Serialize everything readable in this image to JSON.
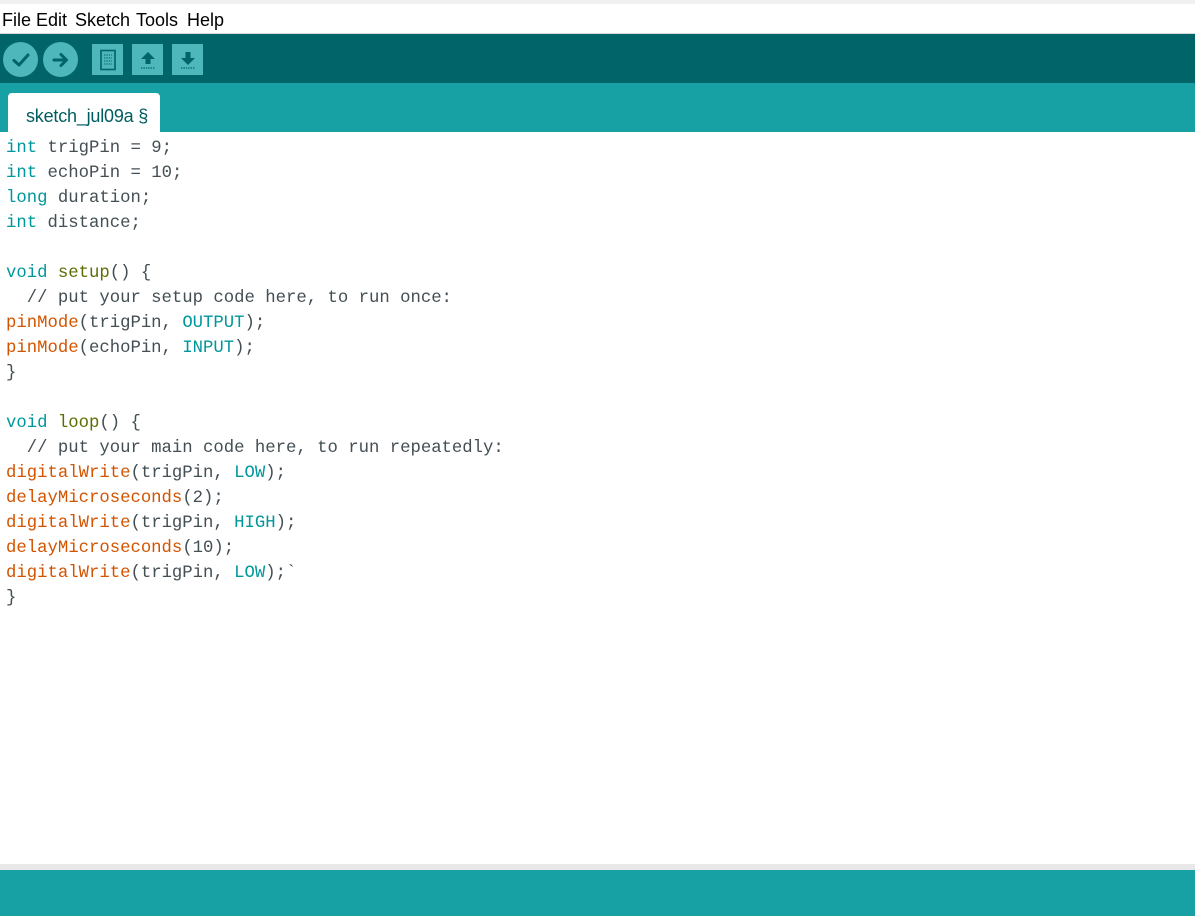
{
  "menu": {
    "items": [
      "File",
      "Edit",
      "Sketch",
      "Tools",
      "Help"
    ]
  },
  "toolbar": {
    "buttons": [
      {
        "name": "verify",
        "icon": "checkmark-icon"
      },
      {
        "name": "upload",
        "icon": "arrow-right-icon"
      },
      {
        "name": "new",
        "icon": "new-file-icon"
      },
      {
        "name": "open",
        "icon": "arrow-up-icon"
      },
      {
        "name": "save",
        "icon": "arrow-down-icon"
      }
    ]
  },
  "tab": {
    "label": "sketch_jul09a §"
  },
  "code": {
    "lines": [
      [
        {
          "t": "int",
          "c": "kw"
        },
        {
          "t": " trigPin = 9;"
        }
      ],
      [
        {
          "t": "int",
          "c": "kw"
        },
        {
          "t": " echoPin = 10;"
        }
      ],
      [
        {
          "t": "long",
          "c": "kw"
        },
        {
          "t": " duration;"
        }
      ],
      [
        {
          "t": "int",
          "c": "kw"
        },
        {
          "t": " distance;"
        }
      ],
      [],
      [
        {
          "t": "void",
          "c": "kw"
        },
        {
          "t": " "
        },
        {
          "t": "setup",
          "c": "sp"
        },
        {
          "t": "() {"
        }
      ],
      [
        {
          "t": "  // put your setup code here, to run once:",
          "c": "cm"
        }
      ],
      [
        {
          "t": "pinMode",
          "c": "fn"
        },
        {
          "t": "(trigPin, "
        },
        {
          "t": "OUTPUT",
          "c": "const"
        },
        {
          "t": ");"
        }
      ],
      [
        {
          "t": "pinMode",
          "c": "fn"
        },
        {
          "t": "(echoPin, "
        },
        {
          "t": "INPUT",
          "c": "const"
        },
        {
          "t": ");"
        }
      ],
      [
        {
          "t": "}"
        }
      ],
      [],
      [
        {
          "t": "void",
          "c": "kw"
        },
        {
          "t": " "
        },
        {
          "t": "loop",
          "c": "sp"
        },
        {
          "t": "() {"
        }
      ],
      [
        {
          "t": "  // put your main code here, to run repeatedly:",
          "c": "cm"
        }
      ],
      [
        {
          "t": "digitalWrite",
          "c": "fn"
        },
        {
          "t": "(trigPin, "
        },
        {
          "t": "LOW",
          "c": "const"
        },
        {
          "t": ");"
        }
      ],
      [
        {
          "t": "delayMicroseconds",
          "c": "fn"
        },
        {
          "t": "(2);"
        }
      ],
      [
        {
          "t": "digitalWrite",
          "c": "fn"
        },
        {
          "t": "(trigPin, "
        },
        {
          "t": "HIGH",
          "c": "const"
        },
        {
          "t": ");"
        }
      ],
      [
        {
          "t": "delayMicroseconds",
          "c": "fn"
        },
        {
          "t": "(10);"
        }
      ],
      [
        {
          "t": "digitalWrite",
          "c": "fn"
        },
        {
          "t": "(trigPin, "
        },
        {
          "t": "LOW",
          "c": "const"
        },
        {
          "t": ");`"
        }
      ],
      [
        {
          "t": "}"
        }
      ]
    ]
  },
  "colors": {
    "toolbar_bg": "#006468",
    "tab_strip_bg": "#17a1a5",
    "button_bg": "#4db7bb",
    "keyword": "#00979c",
    "function": "#d35400",
    "text": "#434f54"
  }
}
